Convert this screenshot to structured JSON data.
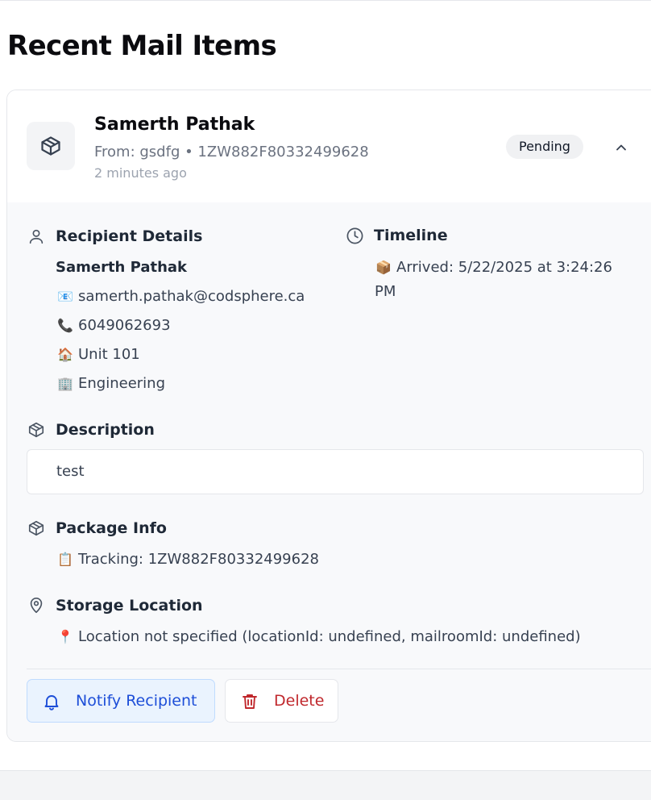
{
  "page": {
    "title": "Recent Mail Items"
  },
  "item": {
    "recipient_name": "Samerth Pathak",
    "from_line": "From: gsdfg • 1ZW882F80332499628",
    "time_ago": "2 minutes ago",
    "status": "Pending",
    "package_icon": "package-icon",
    "collapse_icon": "chevron-up-icon"
  },
  "recipient_details": {
    "heading": "Recipient Details",
    "icon": "user-icon",
    "name": "Samerth Pathak",
    "email_emoji": "📧",
    "email": "samerth.pathak@codsphere.ca",
    "phone_emoji": "📞",
    "phone": "6049062693",
    "unit_emoji": "🏠",
    "unit": "Unit 101",
    "department_emoji": "🏢",
    "department": "Engineering"
  },
  "timeline": {
    "heading": "Timeline",
    "icon": "clock-icon",
    "arrived_emoji": "📦",
    "arrived_line1": "Arrived: 5/22/2025 at 3:24:26",
    "arrived_line2": "PM"
  },
  "description": {
    "heading": "Description",
    "icon": "package-icon",
    "text": "test"
  },
  "package_info": {
    "heading": "Package Info",
    "icon": "package-icon",
    "tracking_emoji": "📋",
    "tracking": "Tracking: 1ZW882F80332499628"
  },
  "storage_location": {
    "heading": "Storage Location",
    "icon": "map-pin-icon",
    "pin_emoji": "📍",
    "text": "Location not specified (locationId: undefined, mailroomId: undefined)"
  },
  "actions": {
    "notify_label": "Notify Recipient",
    "notify_icon": "bell-icon",
    "delete_label": "Delete",
    "delete_icon": "trash-icon"
  },
  "colors": {
    "notify_text": "#1d4ed8",
    "notify_bg": "#eaf3fe",
    "delete_text": "#c0282d",
    "body_bg": "#f8f9fb"
  }
}
